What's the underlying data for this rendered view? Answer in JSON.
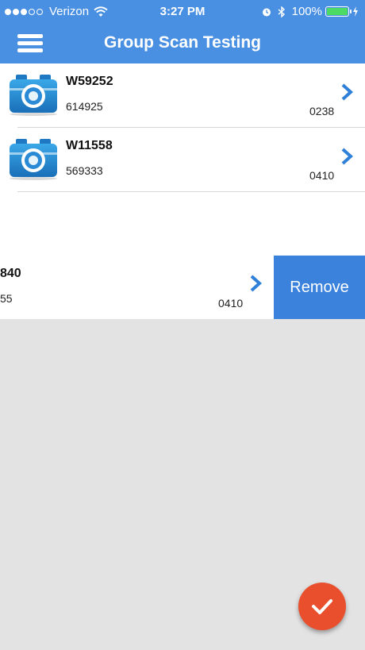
{
  "status_bar": {
    "carrier": "Verizon",
    "time": "3:27 PM",
    "battery": "100%",
    "signal_bars": 3,
    "signal_total": 5
  },
  "header": {
    "title": "Group Scan Testing"
  },
  "items": [
    {
      "title": "W59252",
      "subtitle": "614925",
      "code": "0238"
    },
    {
      "title": "W11558",
      "subtitle": "569333",
      "code": "0410"
    },
    {
      "title": "840",
      "subtitle": "55",
      "code": "0410"
    }
  ],
  "swipe_action": {
    "label": "Remove"
  },
  "colors": {
    "header_blue": "#4a90e2",
    "remove_blue": "#3a82dc",
    "fab_orange": "#e94f2d",
    "chevron_blue": "#2f80d8",
    "background": "#e3e3e3"
  },
  "icons": {
    "menu": "hamburger-icon",
    "row_icon": "camera-icon",
    "row_disclosure": "chevron-right-icon",
    "fab": "checkmark-icon"
  }
}
